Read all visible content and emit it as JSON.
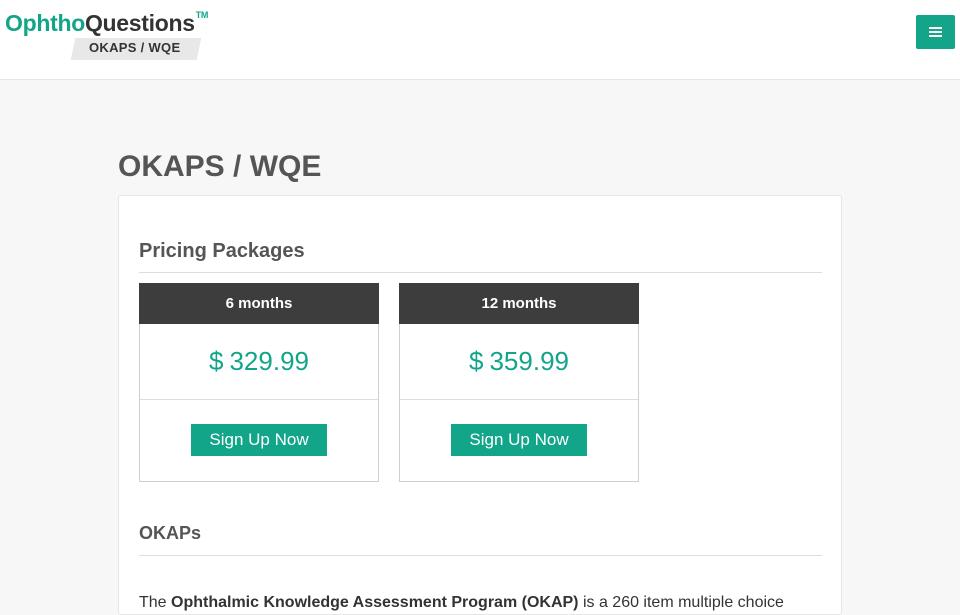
{
  "header": {
    "logo_main_left": "Ophtho",
    "logo_main_right": "Questions",
    "logo_tm": "TM",
    "logo_sub": "OKAPS / WQE",
    "menu_icon": "hamburger-icon"
  },
  "page": {
    "title": "OKAPS / WQE"
  },
  "pricing": {
    "heading": "Pricing Packages",
    "packages": [
      {
        "duration": "6 months",
        "currency": "$",
        "price": "329.99",
        "cta": "Sign Up Now"
      },
      {
        "duration": "12 months",
        "currency": "$",
        "price": "359.99",
        "cta": "Sign Up Now"
      }
    ]
  },
  "okaps": {
    "heading": "OKAPs",
    "intro_prefix": "The ",
    "intro_bold": "Ophthalmic Knowledge Assessment Program (OKAP)",
    "intro_suffix": " is a 260 item multiple choice"
  },
  "colors": {
    "accent": "#12a589",
    "header_dark": "#3d3d3d",
    "background": "#f7f7f7"
  }
}
